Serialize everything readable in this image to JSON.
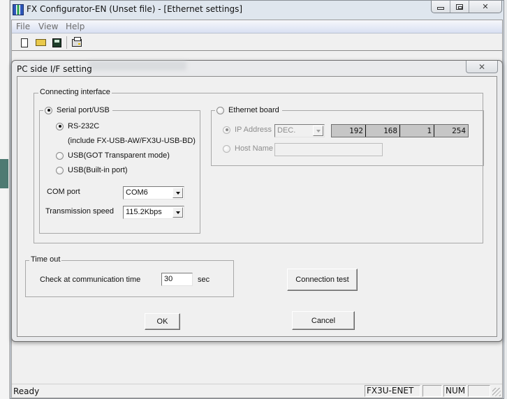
{
  "window": {
    "title": "FX Configurator-EN (Unset file) - [Ethernet settings]",
    "controls": {
      "minimize": "minimize",
      "maximize": "restore",
      "close": "✕"
    }
  },
  "menubar": {
    "items": [
      "File",
      "View",
      "Help"
    ]
  },
  "toolbar": {
    "buttons": [
      "new-file-icon",
      "open-folder-icon",
      "save-disk-icon",
      "print-icon"
    ]
  },
  "dialog": {
    "title": "PC side I/F setting",
    "close": "✕",
    "connecting_interface": {
      "label": "Connecting interface",
      "serial": {
        "label": "Serial port/USB",
        "selected": true,
        "options": [
          {
            "label": "RS-232C",
            "sublabel": "(include FX-USB-AW/FX3U-USB-BD)",
            "selected": true
          },
          {
            "label": "USB(GOT Transparent mode)",
            "selected": false
          },
          {
            "label": "USB(Built-in port)",
            "selected": false
          }
        ],
        "com_port": {
          "label": "COM port",
          "value": "COM6"
        },
        "transmission_speed": {
          "label": "Transmission speed",
          "value": "115.2Kbps"
        }
      },
      "ethernet": {
        "label": "Ethernet board",
        "selected": false,
        "ip_address": {
          "label": "IP Address",
          "format": "DEC.",
          "octets": [
            "192",
            "168",
            "1",
            "254"
          ],
          "selected": true
        },
        "host_name": {
          "label": "Host Name",
          "value": "",
          "selected": false
        }
      }
    },
    "timeout": {
      "label": "Time out",
      "check_label": "Check at communication time",
      "value": "30",
      "unit": "sec"
    },
    "buttons": {
      "connection_test": "Connection test",
      "ok": "OK",
      "cancel": "Cancel"
    }
  },
  "statusbar": {
    "status": "Ready",
    "panes": [
      "FX3U-ENET",
      "",
      "NUM",
      ""
    ]
  }
}
